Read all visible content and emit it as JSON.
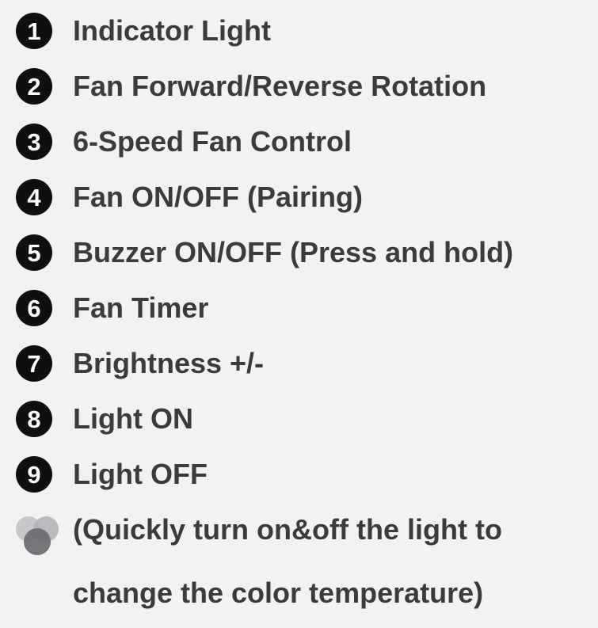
{
  "items": [
    {
      "number": "1",
      "label": "Indicator Light"
    },
    {
      "number": "2",
      "label": "Fan Forward/Reverse Rotation"
    },
    {
      "number": "3",
      "label": "6-Speed Fan Control"
    },
    {
      "number": "4",
      "label": "Fan ON/OFF (Pairing)"
    },
    {
      "number": "5",
      "label": "Buzzer ON/OFF (Press and hold)"
    },
    {
      "number": "6",
      "label": "Fan Timer"
    },
    {
      "number": "7",
      "label": "Brightness +/-"
    },
    {
      "number": "8",
      "label": "Light ON"
    },
    {
      "number": "9",
      "label": "Light OFF"
    }
  ],
  "note": {
    "icon": "color-temperature-icon",
    "line1": "(Quickly turn on&off the light to",
    "line2": "change the color temperature)"
  },
  "colors": {
    "background": "#f2f2f3",
    "badge": "#0f0f0f",
    "text": "#3b3b3b",
    "icon_light": "#c8c8cc",
    "icon_mid": "#9a9aa0",
    "icon_dark": "#5e5e64"
  }
}
